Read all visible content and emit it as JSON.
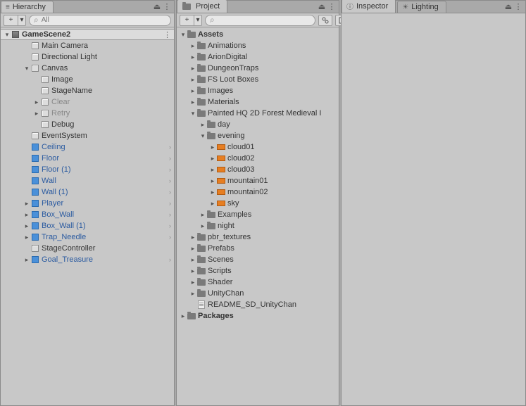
{
  "hierarchy": {
    "tab": "Hierarchy",
    "searchPlaceholder": "All",
    "scene": "GameScene2",
    "items": [
      {
        "name": "Main Camera",
        "type": "go",
        "indent": 2
      },
      {
        "name": "Directional Light",
        "type": "go",
        "indent": 2
      },
      {
        "name": "Canvas",
        "type": "go",
        "indent": 2,
        "fold": "expanded"
      },
      {
        "name": "Image",
        "type": "go",
        "indent": 3
      },
      {
        "name": "StageName",
        "type": "go",
        "indent": 3
      },
      {
        "name": "Clear",
        "type": "go",
        "indent": 3,
        "fold": "collapsed",
        "dim": true
      },
      {
        "name": "Retry",
        "type": "go",
        "indent": 3,
        "fold": "collapsed",
        "dim": true
      },
      {
        "name": "Debug",
        "type": "go",
        "indent": 3
      },
      {
        "name": "EventSystem",
        "type": "go",
        "indent": 2
      },
      {
        "name": "Ceiling",
        "type": "prefab",
        "indent": 2,
        "arrow": true
      },
      {
        "name": "Floor",
        "type": "prefab",
        "indent": 2,
        "arrow": true
      },
      {
        "name": "Floor (1)",
        "type": "prefab",
        "indent": 2,
        "arrow": true
      },
      {
        "name": "Wall",
        "type": "prefab",
        "indent": 2,
        "arrow": true
      },
      {
        "name": "Wall (1)",
        "type": "prefab",
        "indent": 2,
        "arrow": true
      },
      {
        "name": "Player",
        "type": "prefab",
        "indent": 2,
        "fold": "collapsed",
        "arrow": true
      },
      {
        "name": "Box_Wall",
        "type": "prefab",
        "indent": 2,
        "fold": "collapsed",
        "arrow": true
      },
      {
        "name": "Box_Wall (1)",
        "type": "prefab",
        "indent": 2,
        "fold": "collapsed",
        "arrow": true
      },
      {
        "name": "Trap_Needle",
        "type": "prefab",
        "indent": 2,
        "fold": "collapsed",
        "arrow": true
      },
      {
        "name": "StageController",
        "type": "go",
        "indent": 2
      },
      {
        "name": "Goal_Treasure",
        "type": "prefab",
        "indent": 2,
        "fold": "collapsed",
        "arrow": true
      }
    ]
  },
  "project": {
    "tab": "Project",
    "hiddenCount": "8",
    "items": [
      {
        "name": "Assets",
        "type": "folder",
        "indent": 0,
        "fold": "expanded",
        "bold": true
      },
      {
        "name": "Animations",
        "type": "folder",
        "indent": 1,
        "fold": "collapsed"
      },
      {
        "name": "ArionDigital",
        "type": "folder",
        "indent": 1,
        "fold": "collapsed"
      },
      {
        "name": "DungeonTraps",
        "type": "folder",
        "indent": 1,
        "fold": "collapsed"
      },
      {
        "name": "FS Loot Boxes",
        "type": "folder",
        "indent": 1,
        "fold": "collapsed"
      },
      {
        "name": "Images",
        "type": "folder",
        "indent": 1,
        "fold": "collapsed"
      },
      {
        "name": "Materials",
        "type": "folder",
        "indent": 1,
        "fold": "collapsed"
      },
      {
        "name": "Painted HQ 2D Forest Medieval I",
        "type": "folder",
        "indent": 1,
        "fold": "expanded"
      },
      {
        "name": "day",
        "type": "folder",
        "indent": 2,
        "fold": "collapsed"
      },
      {
        "name": "evening",
        "type": "folder",
        "indent": 2,
        "fold": "expanded"
      },
      {
        "name": "cloud01",
        "type": "sprite",
        "indent": 3,
        "fold": "collapsed"
      },
      {
        "name": "cloud02",
        "type": "sprite",
        "indent": 3,
        "fold": "collapsed"
      },
      {
        "name": "cloud03",
        "type": "sprite",
        "indent": 3,
        "fold": "collapsed"
      },
      {
        "name": "mountain01",
        "type": "sprite",
        "indent": 3,
        "fold": "collapsed"
      },
      {
        "name": "mountain02",
        "type": "sprite",
        "indent": 3,
        "fold": "collapsed"
      },
      {
        "name": "sky",
        "type": "sprite",
        "indent": 3,
        "fold": "collapsed"
      },
      {
        "name": "Examples",
        "type": "folder",
        "indent": 2,
        "fold": "collapsed"
      },
      {
        "name": "night",
        "type": "folder",
        "indent": 2,
        "fold": "collapsed"
      },
      {
        "name": "pbr_textures",
        "type": "folder",
        "indent": 1,
        "fold": "collapsed"
      },
      {
        "name": "Prefabs",
        "type": "folder",
        "indent": 1,
        "fold": "collapsed"
      },
      {
        "name": "Scenes",
        "type": "folder",
        "indent": 1,
        "fold": "collapsed"
      },
      {
        "name": "Scripts",
        "type": "folder",
        "indent": 1,
        "fold": "collapsed"
      },
      {
        "name": "Shader",
        "type": "folder",
        "indent": 1,
        "fold": "collapsed"
      },
      {
        "name": "UnityChan",
        "type": "folder",
        "indent": 1,
        "fold": "collapsed"
      },
      {
        "name": "README_SD_UnityChan",
        "type": "text",
        "indent": 1
      },
      {
        "name": "Packages",
        "type": "folder",
        "indent": 0,
        "fold": "collapsed",
        "bold": true
      }
    ]
  },
  "inspector": {
    "tab": "Inspector"
  },
  "lighting": {
    "tab": "Lighting"
  }
}
